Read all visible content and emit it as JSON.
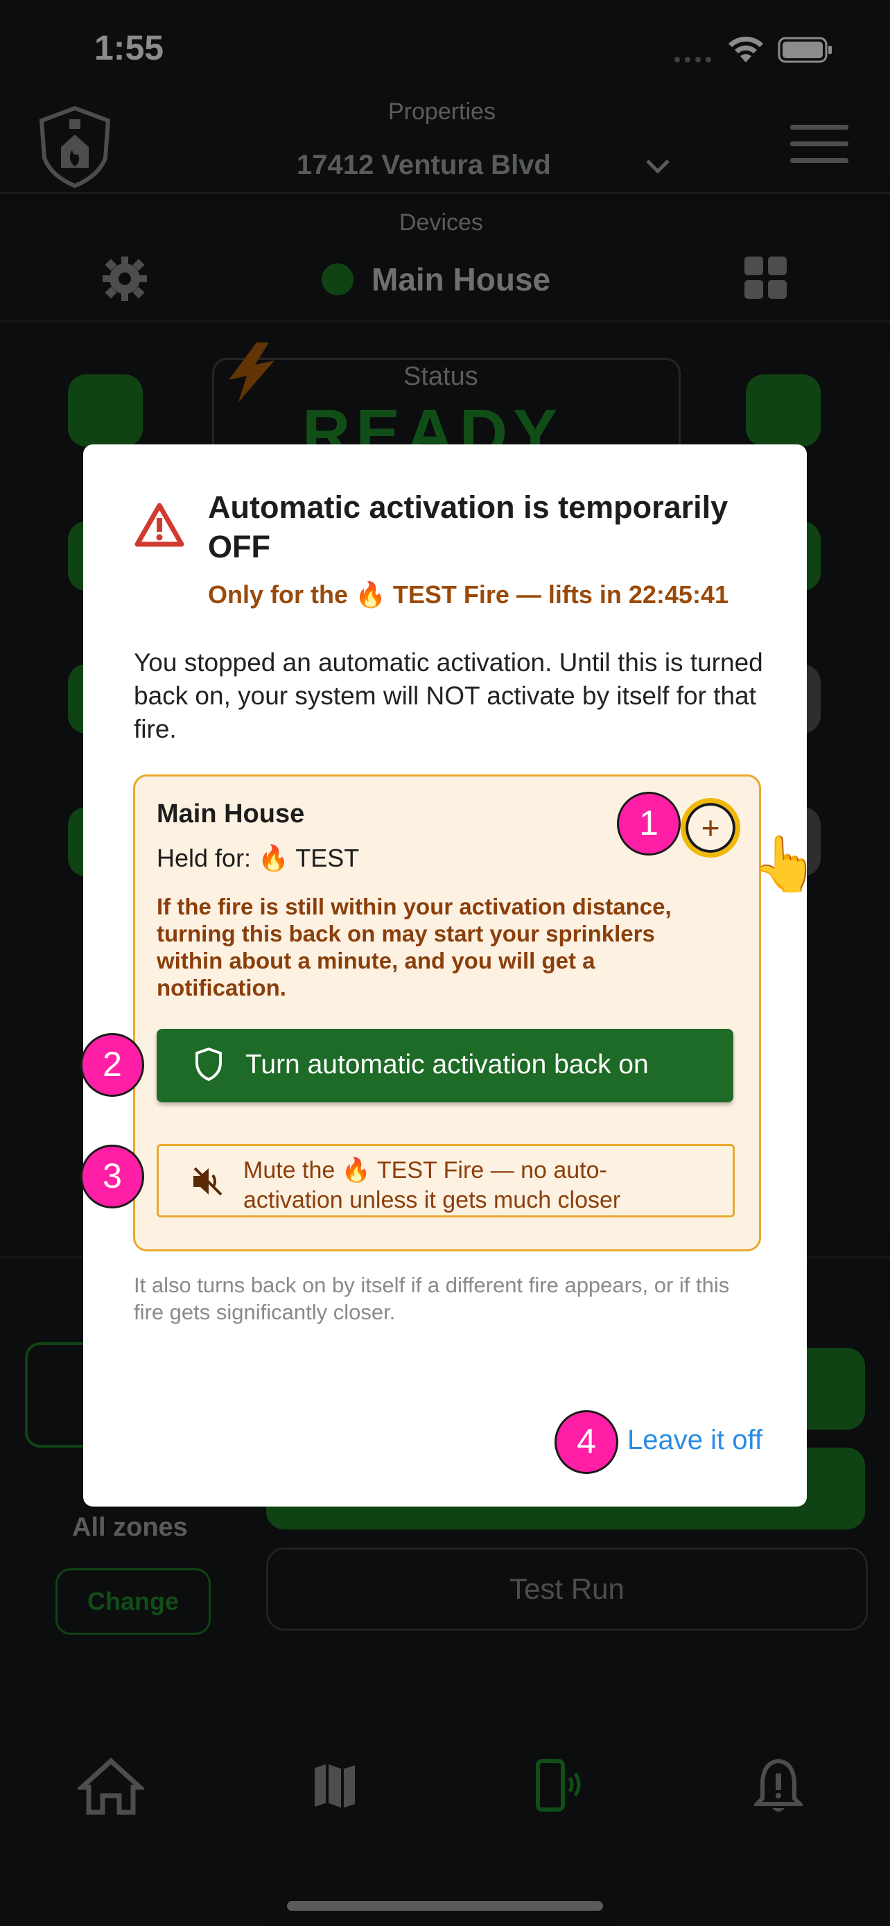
{
  "status_bar": {
    "time": "1:55"
  },
  "header": {
    "properties_label": "Properties",
    "property_name": "17412 Ventura Blvd",
    "devices_label": "Devices",
    "device_name": "Main House"
  },
  "background": {
    "status_label": "Status",
    "status_value": "READY",
    "zones_label": "All zones",
    "change_label": "Change",
    "test_run_label": "Test Run"
  },
  "modal": {
    "title": "Automatic activation is temporarily OFF",
    "subtitle": "Only for the 🔥 TEST Fire — lifts in 22:45:41",
    "body": "You stopped an automatic activation. Until this is turned back on, your system will NOT activate by itself for that fire.",
    "card": {
      "title": "Main House",
      "held_for": "Held for: 🔥 TEST",
      "warning": "If the fire is still within your activation distance, turning this back on may start your sprinklers within about a minute, and you will get a notification.",
      "primary_button": "Turn automatic activation back on",
      "mute_button": "Mute the 🔥 TEST Fire — no auto-activation unless it gets much closer",
      "expand_symbol": "+"
    },
    "footnote": "It also turns back on by itself if a different fire appears, or if this fire gets significantly closer.",
    "leave_off": "Leave it off"
  },
  "annotations": [
    "1",
    "2",
    "3",
    "4"
  ],
  "colors": {
    "accent_green": "#1e6a27",
    "warning_orange": "#e9a92b",
    "annotation_pink": "#ff1fa6",
    "link_blue": "#2b8ce4",
    "alert_red": "#d23a2f"
  }
}
